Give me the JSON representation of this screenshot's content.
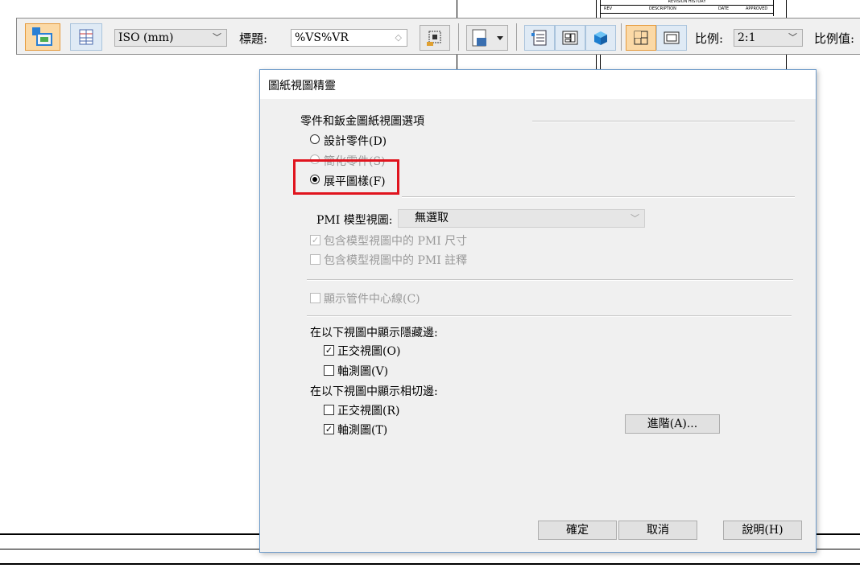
{
  "toolbar": {
    "standard_combo": "ISO (mm)",
    "caption_label": "標題:",
    "caption_value": "%VS%VR",
    "scale_label": "比例:",
    "scale_value": "2:1",
    "scale_value_label": "比例值:"
  },
  "title_block": {
    "revision_history": "REVISION HISTORY",
    "rev": "REV",
    "description": "DESCRIPTION",
    "date": "DATE",
    "approved": "APPROVED"
  },
  "dialog": {
    "title": "圖紙視圖精靈",
    "group_title": "零件和鈑金圖紙視圖選項",
    "radio_design": "設計零件(D)",
    "radio_simplified": "簡化零件(S)",
    "radio_flat": "展平圖樣(F)",
    "pmi_label": "PMI 模型視圖:",
    "pmi_value": "無選取",
    "chk_pmi_dims": "包含模型視圖中的 PMI 尺寸",
    "chk_pmi_annot": "包含模型視圖中的 PMI 註釋",
    "chk_tube_centerlines": "顯示管件中心線(C)",
    "hidden_edges_title": "在以下視圖中顯示隱藏邊:",
    "hidden_ortho": "正交視圖(O)",
    "hidden_iso": "軸測圖(V)",
    "tangent_edges_title": "在以下視圖中顯示相切邊:",
    "tangent_ortho": "正交視圖(R)",
    "tangent_iso": "軸測圖(T)",
    "advanced_button": "進階(A)...",
    "ok_button": "確定",
    "cancel_button": "取消",
    "help_button": "說明(H)"
  },
  "colors": {
    "highlight": "#e0141e",
    "active_button": "#fbd9a6",
    "button_face": "#dfeaf5"
  }
}
